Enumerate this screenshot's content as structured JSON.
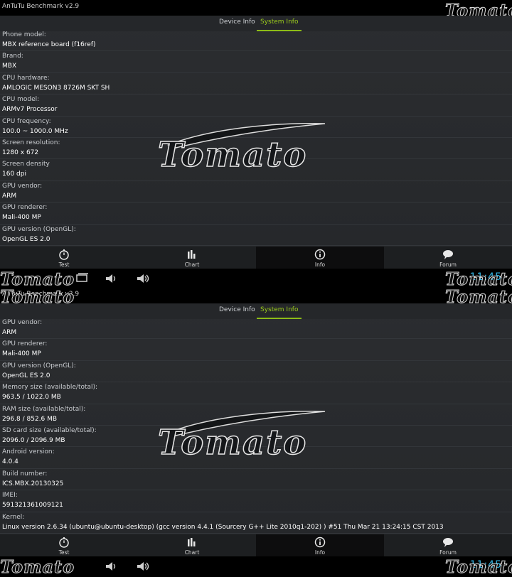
{
  "app_title": "AnTuTu Benchmark v2.9",
  "watermark": "Tomato",
  "tabs": {
    "device_info": "Device Info",
    "system_info": "System Info"
  },
  "nav": {
    "test": "Test",
    "chart": "Chart",
    "info": "Info",
    "forum": "Forum"
  },
  "status_time": "11:45",
  "accent_color": "#8dbb17",
  "clock_color": "#33b5e5",
  "top_rows": [
    {
      "label": "Phone model:",
      "value": "MBX reference board (f16ref)"
    },
    {
      "label": "Brand:",
      "value": "MBX"
    },
    {
      "label": "CPU hardware:",
      "value": "AMLOGIC MESON3 8726M SKT SH"
    },
    {
      "label": "CPU model:",
      "value": "ARMv7 Processor"
    },
    {
      "label": "CPU frequency:",
      "value": "100.0 ~ 1000.0 MHz"
    },
    {
      "label": "Screen resolution:",
      "value": "1280 x 672"
    },
    {
      "label": "Screen density",
      "value": "160 dpi"
    },
    {
      "label": "GPU vendor:",
      "value": "ARM"
    },
    {
      "label": "GPU renderer:",
      "value": "Mali-400 MP"
    },
    {
      "label": "GPU version (OpenGL):",
      "value": "OpenGL ES 2.0"
    }
  ],
  "bottom_rows": [
    {
      "label": "GPU vendor:",
      "value": "ARM"
    },
    {
      "label": "GPU renderer:",
      "value": "Mali-400 MP"
    },
    {
      "label": "GPU version (OpenGL):",
      "value": "OpenGL ES 2.0"
    },
    {
      "label": "Memory size (available/total):",
      "value": "963.5 / 1022.0 MB"
    },
    {
      "label": "RAM size (available/total):",
      "value": "296.8 / 852.6 MB"
    },
    {
      "label": "SD card size (available/total):",
      "value": "2096.0 / 2096.9 MB"
    },
    {
      "label": "Android version:",
      "value": "4.0.4"
    },
    {
      "label": "Build number:",
      "value": "ICS.MBX.20130325"
    },
    {
      "label": "IMEI:",
      "value": "591321361009121"
    },
    {
      "label": "Kernel:",
      "value": "Linux version 2.6.34 (ubuntu@ubuntu-desktop) (gcc version 4.4.1 (Sourcery G++ Lite 2010q1-202) ) #51 Thu Mar 21 13:24:15 CST 2013"
    }
  ]
}
